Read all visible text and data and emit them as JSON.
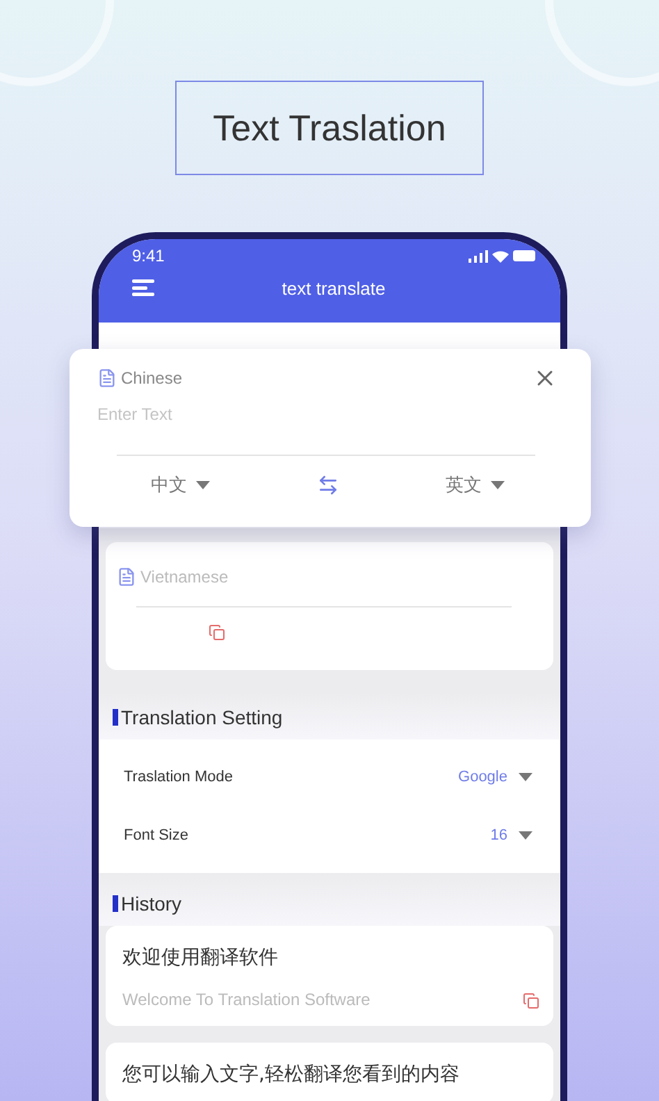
{
  "heading": "Text Traslation",
  "status_bar": {
    "time": "9:41"
  },
  "header": {
    "title": "text translate"
  },
  "source": {
    "language": "Chinese",
    "placeholder": "Enter Text",
    "from": "中文",
    "to": "英文"
  },
  "target": {
    "language": "Vietnamese"
  },
  "settings": {
    "title": "Translation Setting",
    "rows": [
      {
        "label": "Traslation Mode",
        "value": "Google"
      },
      {
        "label": "Font Size",
        "value": "16"
      }
    ]
  },
  "history": {
    "title": "History",
    "items": [
      {
        "source": "欢迎使用翻译软件",
        "translation": "Welcome To Translation Software"
      },
      {
        "source": "您可以输入文字,轻松翻译您看到的内容"
      }
    ]
  }
}
